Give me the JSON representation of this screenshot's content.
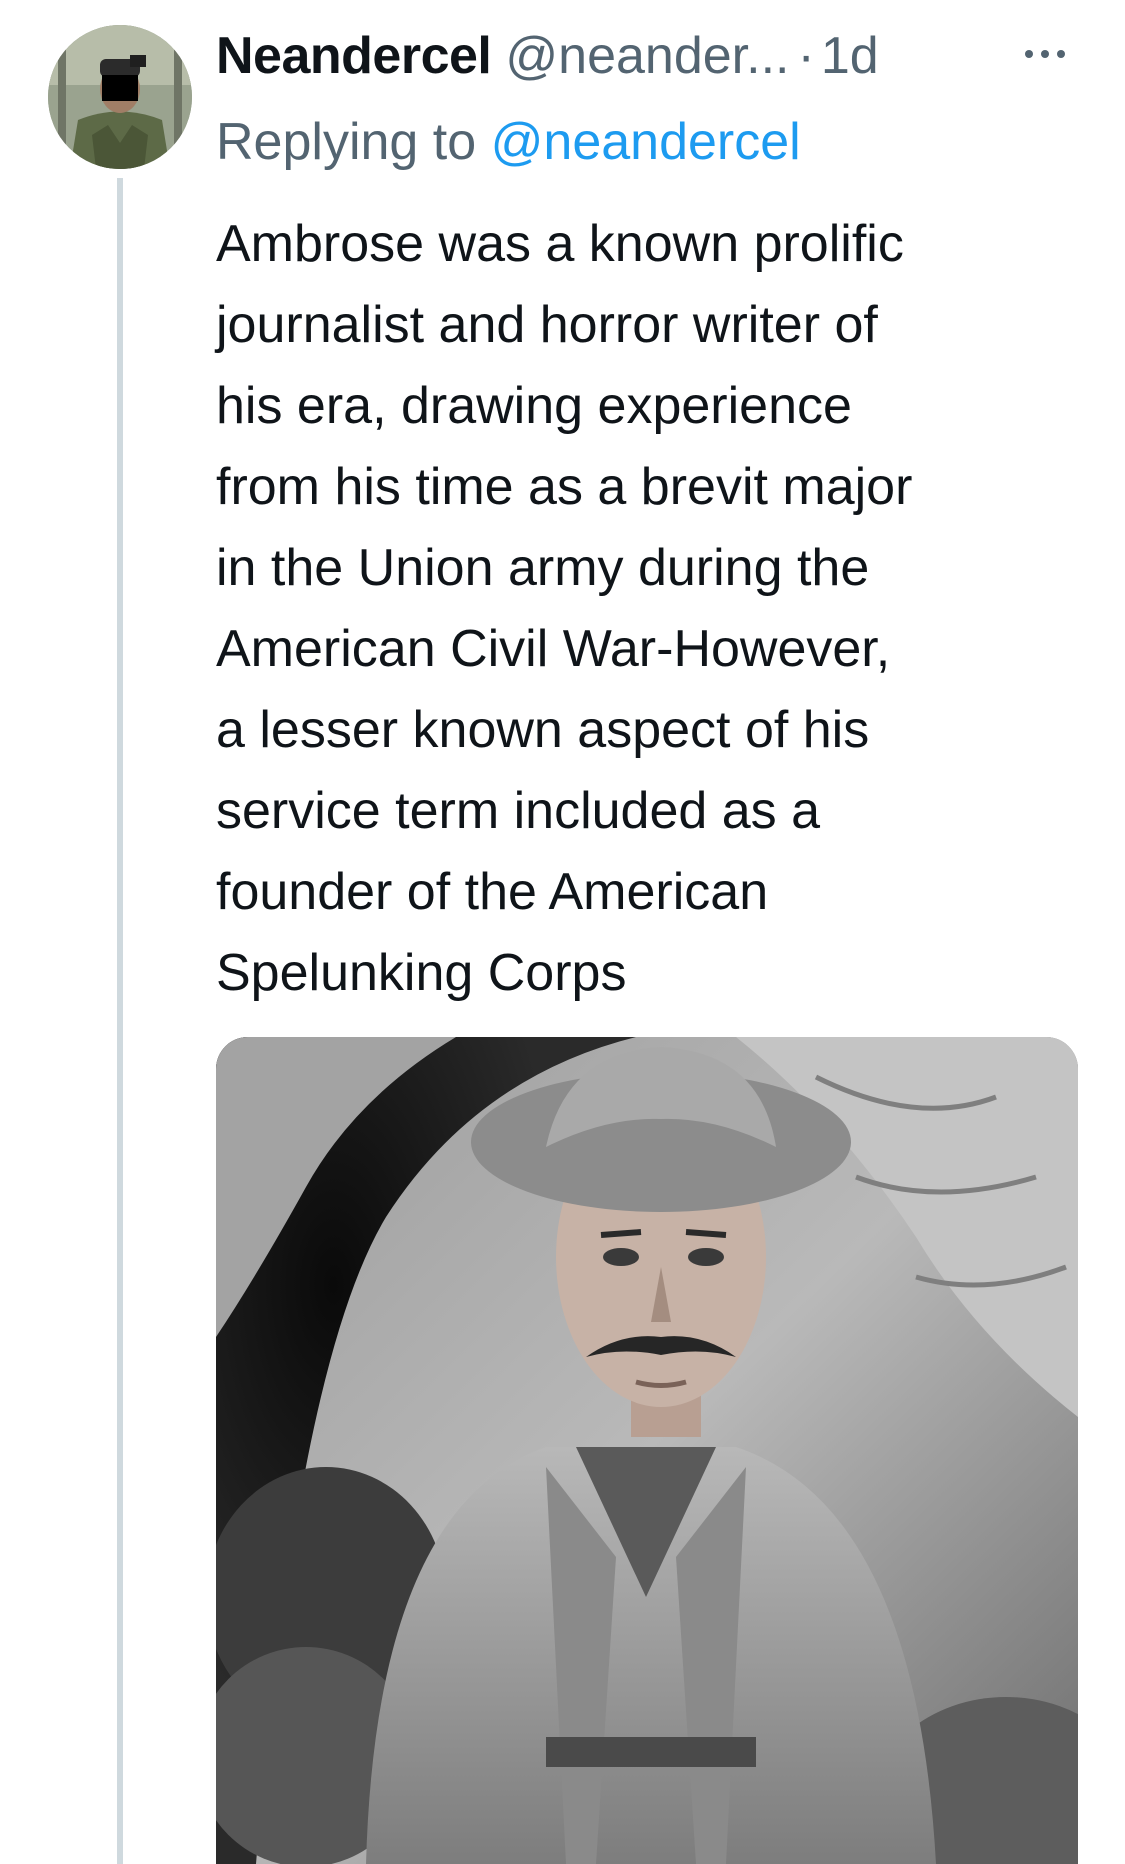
{
  "tweet": {
    "display_name": "Neandercel",
    "handle": "@neander...",
    "separator": "·",
    "time": "1d",
    "reply_prefix": "Replying to",
    "reply_handle": "@neandercel",
    "text_lines": [
      "Ambrose was a known prolific",
      "journalist and horror writer of",
      "his era, drawing experience",
      "from his time as a brevit major",
      "in the Union army during the",
      "American Civil War-However,",
      "a lesser known aspect of his",
      "service term included as a",
      "founder of the American",
      "Spelunking Corps"
    ]
  },
  "icons": {
    "more": "more-horizontal-icon"
  },
  "colors": {
    "text": "#0f1419",
    "secondary": "#536471",
    "link": "#1d9bf0",
    "thread_line": "#cfd9de"
  }
}
